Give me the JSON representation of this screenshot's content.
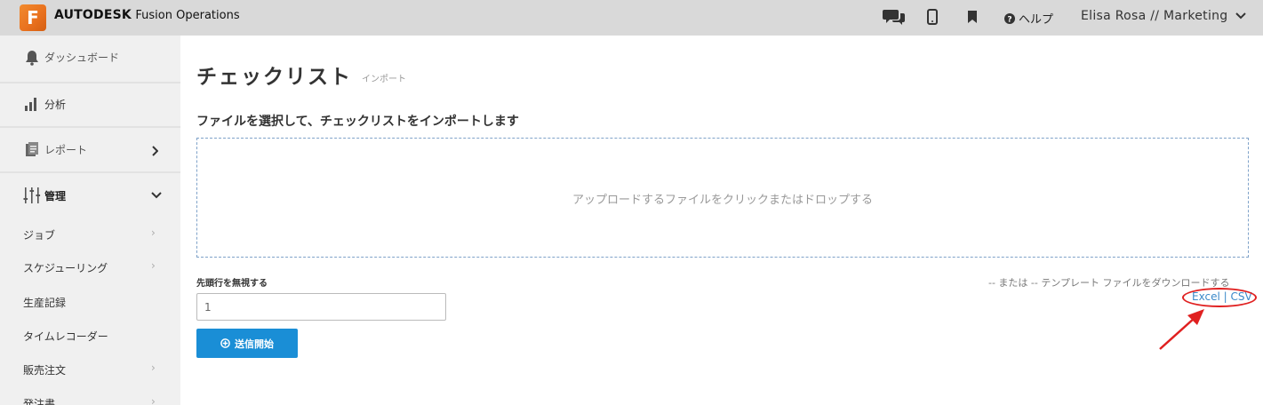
{
  "header": {
    "brand_bold": "AUTODESK",
    "brand_product": "Fusion Operations",
    "logo_letter": "F",
    "icons": [
      "chat-icon",
      "mobile-icon",
      "bookmark-icon"
    ],
    "help_label": "ヘルプ",
    "user_label": "Elisa Rosa // Marketing"
  },
  "sidebar": {
    "items": [
      {
        "label": "ダッシュボード",
        "icon": "bell-icon"
      },
      {
        "label": "分析",
        "icon": "bar-chart-icon"
      },
      {
        "label": "レポート",
        "icon": "report-icon"
      },
      {
        "label": "管理",
        "icon": "sliders-icon"
      }
    ],
    "subitems": [
      {
        "label": "ジョブ",
        "chevron": true
      },
      {
        "label": "スケジューリング",
        "chevron": true
      },
      {
        "label": "生産記録",
        "chevron": false
      },
      {
        "label": "タイムレコーダー",
        "chevron": false
      },
      {
        "label": "販売注文",
        "chevron": true
      },
      {
        "label": "発注書",
        "chevron": true
      }
    ]
  },
  "main": {
    "title": "チェックリスト",
    "subtitle": "インポート",
    "section_title": "ファイルを選択して、チェックリストをインポートします",
    "dropzone_text": "アップロードするファイルをクリックまたはドロップする",
    "skip_label": "先頭行を無視する",
    "skip_value": "1",
    "submit_label": "送信開始",
    "template_text": "-- または -- テンプレート ファイルをダウンロードする",
    "excel_link": "Excel",
    "link_separator": "|",
    "csv_link": "CSV"
  },
  "colors": {
    "accent": "#1a8ed6",
    "logo": "#e8701e",
    "annotation": "#e02020",
    "link": "#3b89c9"
  }
}
